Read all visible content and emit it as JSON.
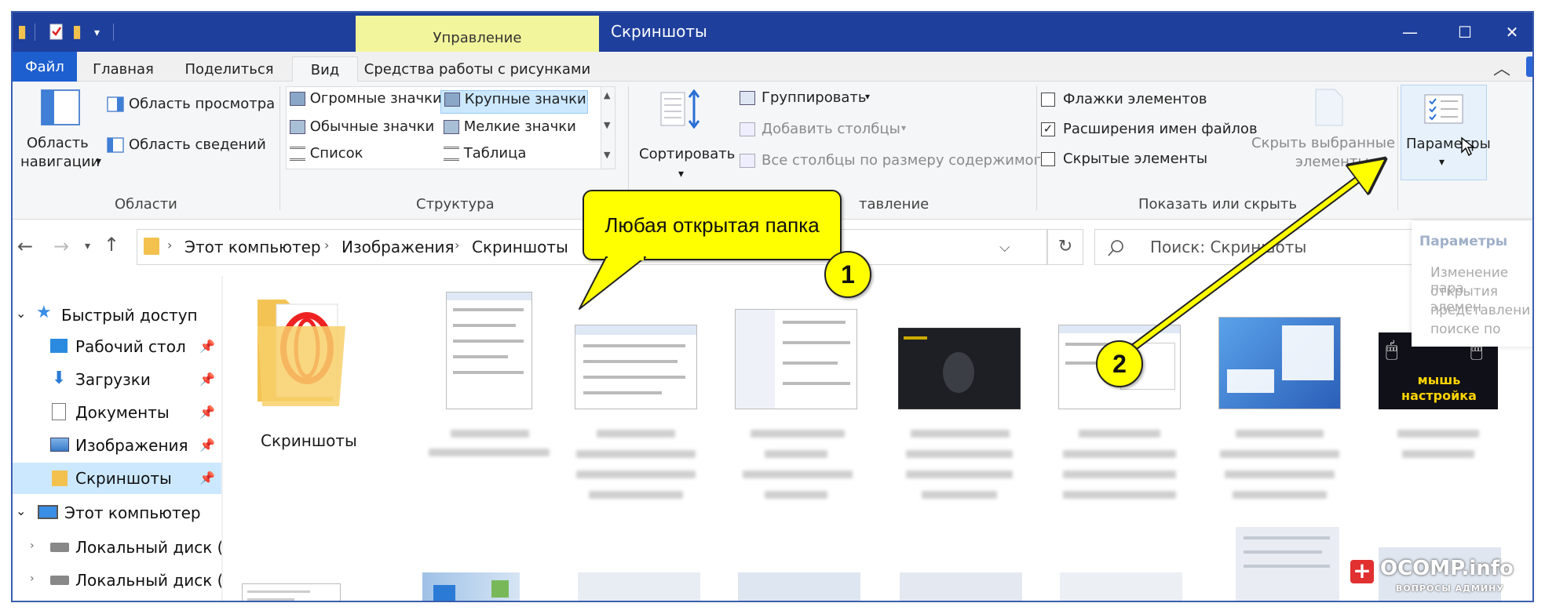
{
  "window": {
    "title": "Скриншоты",
    "context_tab": "Управление",
    "controls": {
      "minimize": "—",
      "maximize": "☐",
      "close": "✕"
    }
  },
  "menu_tabs": [
    "Файл",
    "Главная",
    "Поделиться",
    "Вид",
    "Средства работы с рисунками"
  ],
  "ribbon": {
    "panes": {
      "nav_pane_line1": "Область",
      "nav_pane_line2": "навигации",
      "preview_pane": "Область просмотра",
      "details_pane": "Область сведений",
      "group_label": "Области"
    },
    "layout": {
      "options": [
        "Огромные значки",
        "Крупные значки",
        "Обычные значки",
        "Мелкие значки",
        "Список",
        "Таблица"
      ],
      "selected": "Крупные значки",
      "group_label": "Структура"
    },
    "current_view": {
      "sort_label": "Сортировать",
      "group_by": "Группировать",
      "add_columns": "Добавить столбцы",
      "size_columns": "Все столбцы по размеру содержимого",
      "group_label": "Текущее представление",
      "group_label_visible": "тавление"
    },
    "show_hide": {
      "item_checkboxes": "Флажки элементов",
      "item_checkboxes_checked": false,
      "file_extensions": "Расширения имен файлов",
      "file_extensions_checked": true,
      "hidden_items": "Скрытые элементы",
      "hidden_items_checked": false,
      "hide_selected_line1": "Скрыть выбранные",
      "hide_selected_line2": "элементы",
      "group_label": "Показать или скрыть"
    },
    "options_label": "Параметры"
  },
  "address": {
    "crumbs": [
      "Этот компьютер",
      "Изображения",
      "Скриншоты"
    ],
    "search_placeholder": "Поиск: Скриншоты"
  },
  "tooltip": {
    "title": "Параметры",
    "lines": [
      "Изменение пара",
      "открытия элемен",
      "представлени",
      "поиске по"
    ]
  },
  "nav": {
    "quick_access": "Быстрый доступ",
    "items": [
      {
        "label": "Рабочий стол",
        "pinned": true
      },
      {
        "label": "Загрузки",
        "pinned": true
      },
      {
        "label": "Документы",
        "pinned": true
      },
      {
        "label": "Изображения",
        "pinned": true
      },
      {
        "label": "Скриншоты",
        "pinned": true,
        "selected": true
      }
    ],
    "this_pc": "Этот компьютер",
    "drives": [
      "Локальный диск (C",
      "Локальный диск (D"
    ]
  },
  "content": {
    "folder_name": "Скриншоты",
    "thumb_text": "мышь настройка"
  },
  "annotations": {
    "callout_text": "Любая открытая папка",
    "badge1": "1",
    "badge2": "2",
    "arrow_color": "#ffff00"
  },
  "watermark": {
    "brand": "OCOMP.info",
    "tagline": "ВОПРОСЫ АДМИНУ",
    "plus": "+"
  },
  "colors": {
    "titlebar": "#1e3f9c",
    "file_tab": "#1e5fcf",
    "context_tab": "#f3f59c",
    "selected": "#cce8ff",
    "callout": "#ffff00"
  }
}
